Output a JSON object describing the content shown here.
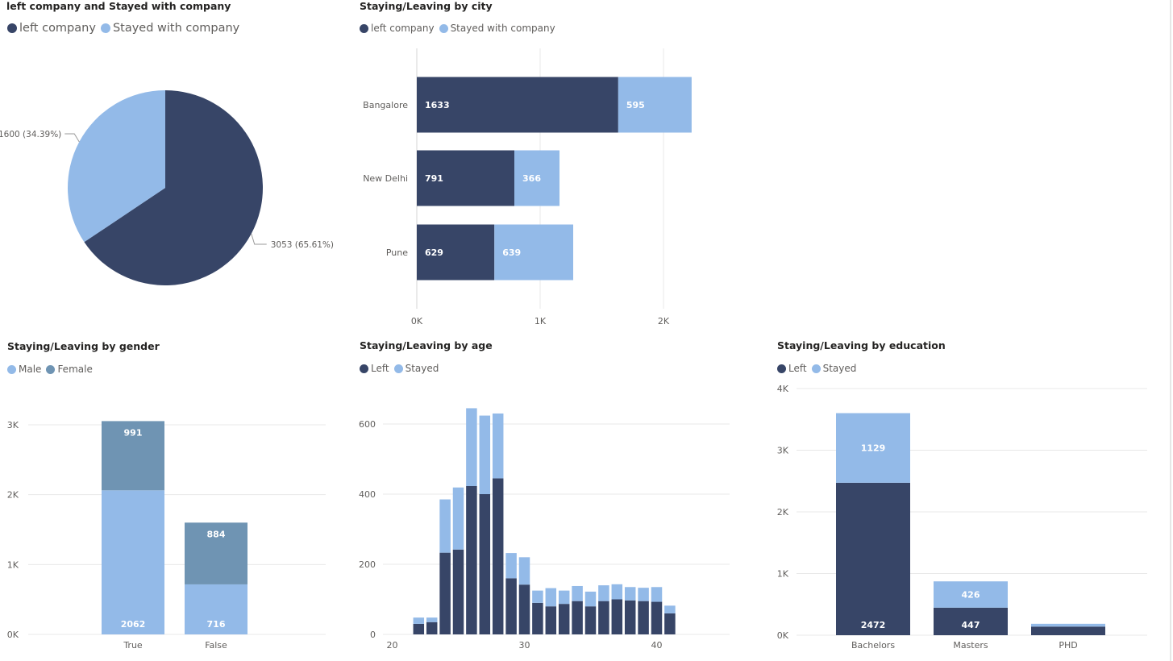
{
  "colors": {
    "dark": "#374567",
    "light": "#93bae8",
    "female": "#6f94b3",
    "grid": "#e8e8e8",
    "axis_text": "#605e5c"
  },
  "chart_data": [
    {
      "id": "pie",
      "type": "pie",
      "title": "left company and Stayed with company",
      "legend": [
        "left company",
        "Stayed with company"
      ],
      "values": [
        3053,
        1600
      ],
      "labels": [
        "3053 (65.61%)",
        "1600 (34.39%)"
      ]
    },
    {
      "id": "city",
      "type": "bar",
      "orientation": "horizontal",
      "stacked": true,
      "title": "Staying/Leaving by city",
      "legend": [
        "left company",
        "Stayed with company"
      ],
      "categories": [
        "Bangalore",
        "New Delhi",
        "Pune"
      ],
      "series": [
        {
          "name": "left company",
          "values": [
            1633,
            791,
            629
          ]
        },
        {
          "name": "Stayed with company",
          "values": [
            595,
            366,
            639
          ]
        }
      ],
      "xlim": [
        0,
        2000
      ],
      "ticks": [
        "0K",
        "1K",
        "2K"
      ],
      "grid": true
    },
    {
      "id": "gender",
      "type": "bar",
      "stacked": true,
      "title": "Staying/Leaving by gender",
      "legend": [
        "Male",
        "Female"
      ],
      "categories": [
        "True",
        "False"
      ],
      "series": [
        {
          "name": "Male",
          "values": [
            2062,
            716
          ]
        },
        {
          "name": "Female",
          "values": [
            991,
            884
          ]
        }
      ],
      "ylim": [
        0,
        3000
      ],
      "ticks": [
        "0K",
        "1K",
        "2K",
        "3K"
      ],
      "grid": true
    },
    {
      "id": "age",
      "type": "bar",
      "stacked": true,
      "title": "Staying/Leaving by age",
      "legend": [
        "Left",
        "Stayed"
      ],
      "x": [
        22,
        23,
        24,
        25,
        26,
        27,
        28,
        29,
        30,
        31,
        32,
        33,
        34,
        35,
        36,
        37,
        38,
        39,
        40,
        41
      ],
      "series": [
        {
          "name": "Left",
          "values": [
            30,
            35,
            233,
            242,
            423,
            400,
            445,
            160,
            142,
            90,
            80,
            87,
            95,
            80,
            95,
            100,
            97,
            95,
            93,
            60
          ]
        },
        {
          "name": "Stayed",
          "values": [
            18,
            13,
            152,
            177,
            222,
            224,
            185,
            72,
            78,
            35,
            52,
            38,
            43,
            42,
            45,
            43,
            38,
            38,
            42,
            22
          ]
        }
      ],
      "ylim": [
        0,
        600
      ],
      "xticks": [
        20,
        30,
        40
      ],
      "yticks": [
        0,
        200,
        400,
        600
      ],
      "grid": true
    },
    {
      "id": "education",
      "type": "bar",
      "stacked": true,
      "title": "Staying/Leaving by education",
      "legend": [
        "Left",
        "Stayed"
      ],
      "categories": [
        "Bachelors",
        "Masters",
        "PHD"
      ],
      "series": [
        {
          "name": "Left",
          "values": [
            2472,
            447,
            140
          ]
        },
        {
          "name": "Stayed",
          "values": [
            1129,
            426,
            45
          ]
        }
      ],
      "data_labels": [
        [
          "2472",
          "447",
          ""
        ],
        [
          "1129",
          "426",
          ""
        ]
      ],
      "ylim": [
        0,
        4000
      ],
      "ticks": [
        "0K",
        "1K",
        "2K",
        "3K",
        "4K"
      ],
      "grid": true
    }
  ]
}
